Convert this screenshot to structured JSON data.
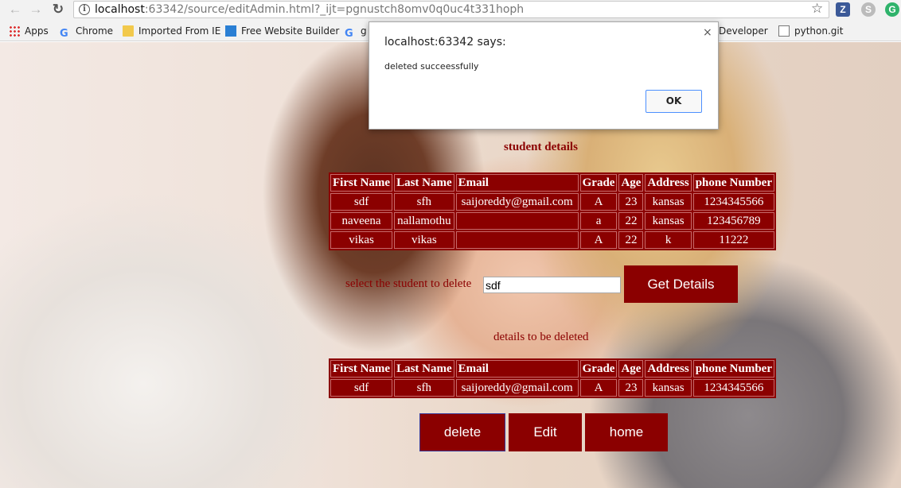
{
  "browser": {
    "back_icon": "arrow-left-icon",
    "forward_icon": "arrow-right-icon",
    "reload_icon": "reload-icon",
    "url_host": "localhost",
    "url_rest": ":63342/source/editAdmin.html?_ijt=pgnustch8omv0q0uc4t331hoph",
    "bookmarks": [
      "Apps",
      "Chrome",
      "Imported From IE",
      "Free Website Builder",
      "g",
      "Developer",
      "python.git"
    ]
  },
  "dialog": {
    "title": "localhost:63342 says:",
    "message": "deleted succeessfully",
    "ok_label": "OK",
    "close_label": "×"
  },
  "page": {
    "heading": "student details",
    "headers": [
      "First Name",
      "Last Name",
      "Email",
      "Grade",
      "Age",
      "Address",
      "phone Number"
    ],
    "students": [
      [
        "sdf",
        "sfh",
        "saijoreddy@gmail.com",
        "A",
        "23",
        "kansas",
        "1234345566"
      ],
      [
        "naveena",
        "nallamothu",
        "",
        "a",
        "22",
        "kansas",
        "123456789"
      ],
      [
        "vikas",
        "vikas",
        "",
        "A",
        "22",
        "k",
        "11222"
      ]
    ],
    "select_label": "select the student to delete",
    "select_value": "sdf",
    "get_details_label": "Get Details",
    "details_label": "details to be deleted",
    "details_rows": [
      [
        "sdf",
        "sfh",
        "saijoreddy@gmail.com",
        "A",
        "23",
        "kansas",
        "1234345566"
      ]
    ],
    "delete_label": "delete",
    "edit_label": "Edit",
    "home_label": "home"
  },
  "colors": {
    "accent": "#8b0000"
  }
}
